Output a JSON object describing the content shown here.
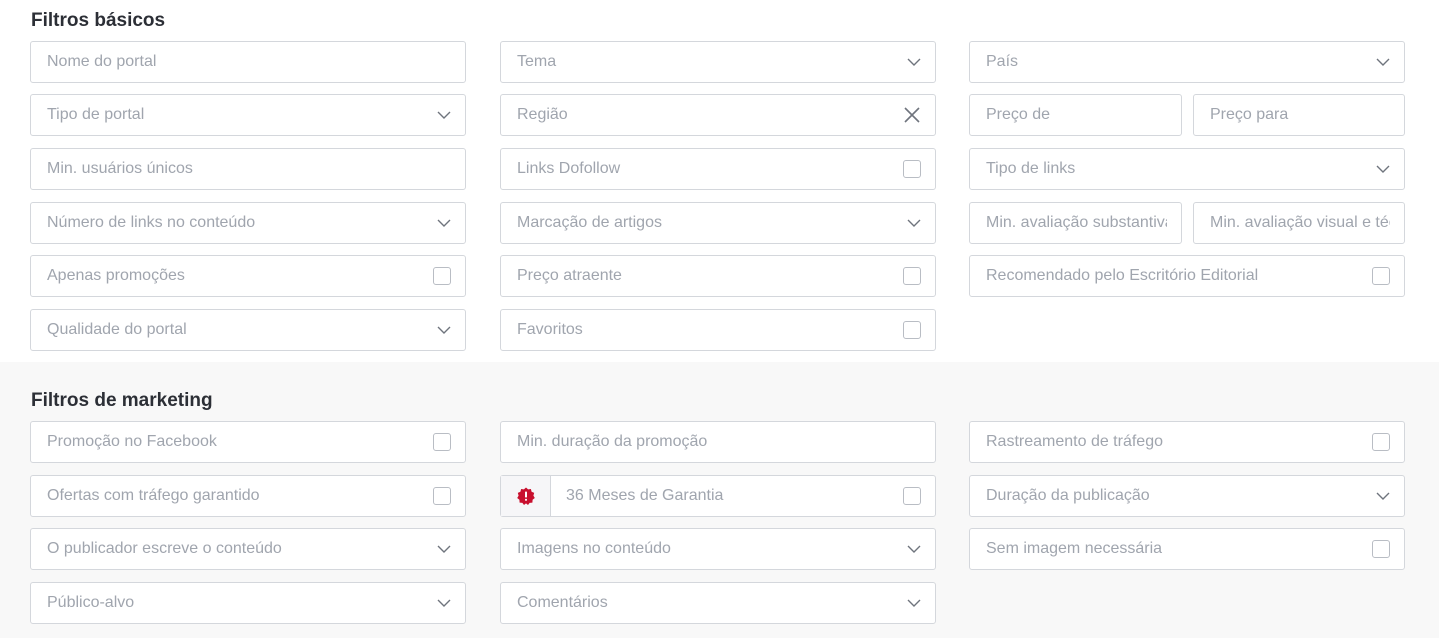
{
  "basic_filters": {
    "title": "Filtros básicos",
    "portal_name_placeholder": "Nome do portal",
    "theme": "Tema",
    "country": "País",
    "portal_type": "Tipo de portal",
    "region": "Região",
    "price_from_placeholder": "Preço de",
    "price_to_placeholder": "Preço para",
    "min_unique_users_placeholder": "Min. usuários únicos",
    "dofollow_links": "Links Dofollow",
    "link_type": "Tipo de links",
    "content_link_count": "Número de links no conteúdo",
    "article_marking": "Marcação de artigos",
    "min_substantive_rating_placeholder": "Min. avaliação substantiva",
    "min_visual_rating_placeholder": "Min. avaliação visual e técnica",
    "promotions_only": "Apenas promoções",
    "attractive_price": "Preço atraente",
    "editorial_recommended": "Recomendado pelo Escritório Editorial",
    "portal_quality": "Qualidade do portal",
    "favorites": "Favoritos"
  },
  "marketing_filters": {
    "title": "Filtros de marketing",
    "facebook_promotion": "Promoção no Facebook",
    "min_promotion_duration_placeholder": "Min. duração da promoção",
    "traffic_tracking": "Rastreamento de tráfego",
    "guaranteed_traffic_offers": "Ofertas com tráfego garantido",
    "guarantee_36_months": "36 Meses de Garantia",
    "publication_duration": "Duração da publicação",
    "publisher_writes_content": "O publicador escreve o conteúdo",
    "content_images": "Imagens no conteúdo",
    "no_image_needed": "Sem imagem necessária",
    "target_audience": "Público-alvo",
    "comments": "Comentários"
  },
  "colors": {
    "border": "#d4d7dc",
    "placeholder_text": "#a0a5ae",
    "title_text": "#2c2f36",
    "marketing_bg": "#f8f8f8",
    "warning_badge": "#c8102e"
  },
  "icons": {
    "select": "chevron-down-icon",
    "clear": "close-icon",
    "checkbox": "checkbox-icon",
    "warning": "warning-badge-icon"
  }
}
